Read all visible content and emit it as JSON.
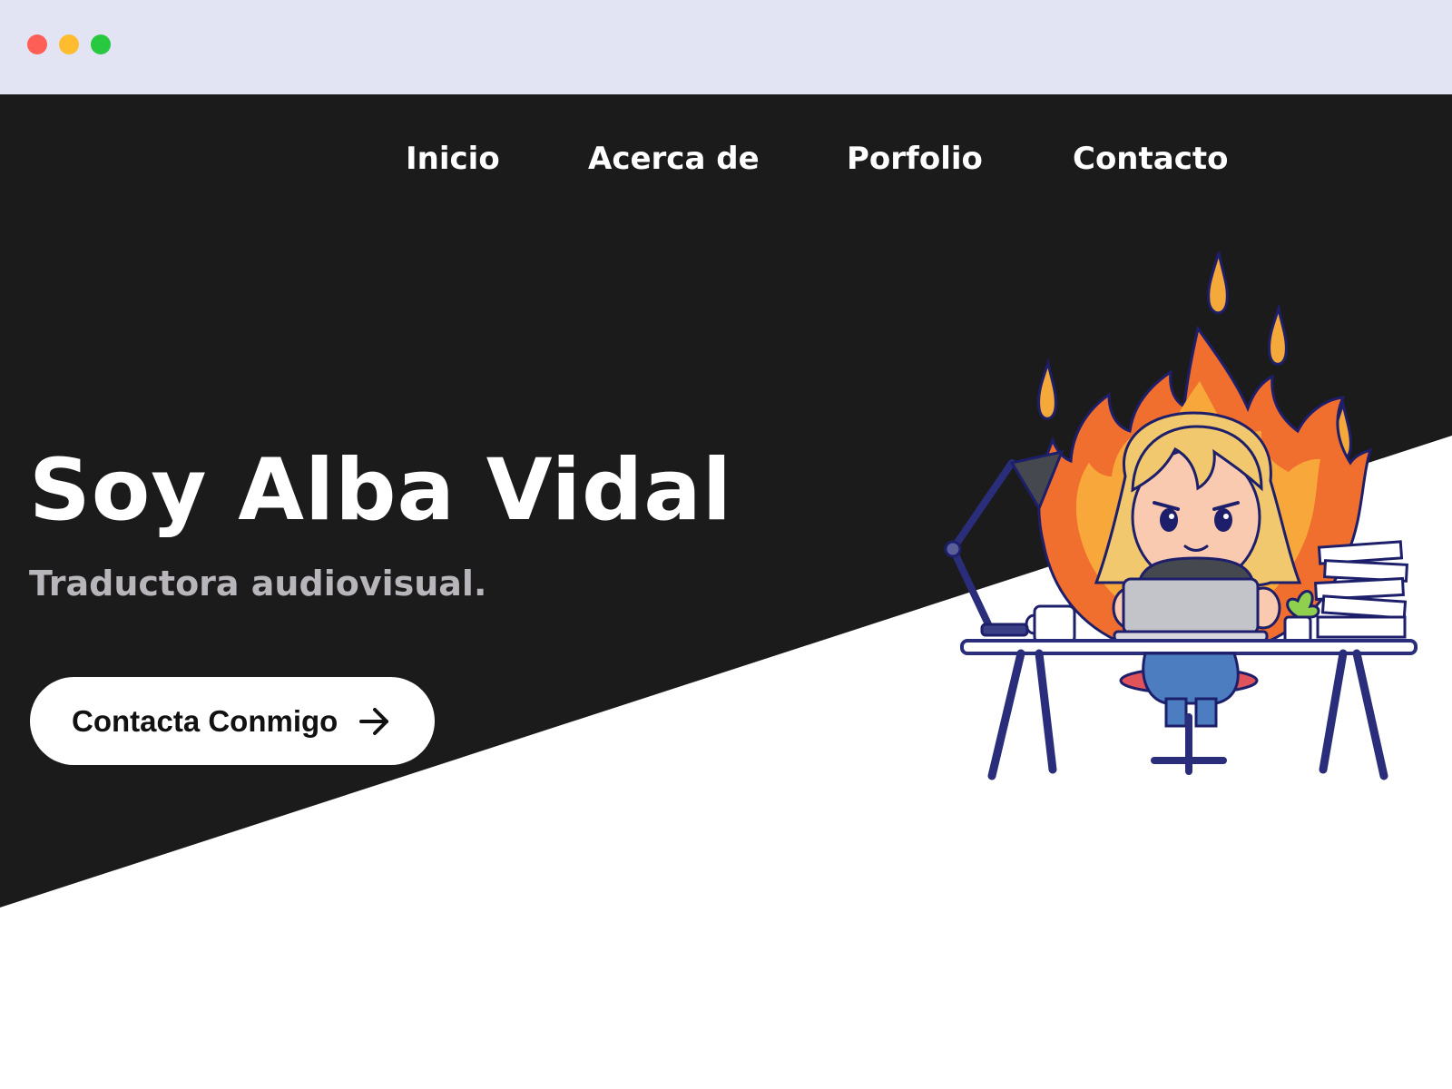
{
  "browser": {
    "window_controls": [
      "close",
      "minimize",
      "maximize"
    ]
  },
  "nav": {
    "items": [
      {
        "label": "Inicio"
      },
      {
        "label": "Acerca de"
      },
      {
        "label": "Porfolio"
      },
      {
        "label": "Contacto"
      }
    ]
  },
  "hero": {
    "title": "Soy Alba Vidal",
    "subtitle": "Traductora audiovisual.",
    "cta_label": "Contacta Conmigo",
    "cta_icon": "arrow-right-icon",
    "illustration": "woman-on-fire-at-desk-illustration"
  },
  "colors": {
    "chrome_bar": "#e3e4f3",
    "hero_background": "#1c1b1c",
    "nav_text": "#ffffff",
    "subtitle_text": "#b8b6ba",
    "cta_background": "#ffffff",
    "cta_text": "#111111"
  }
}
